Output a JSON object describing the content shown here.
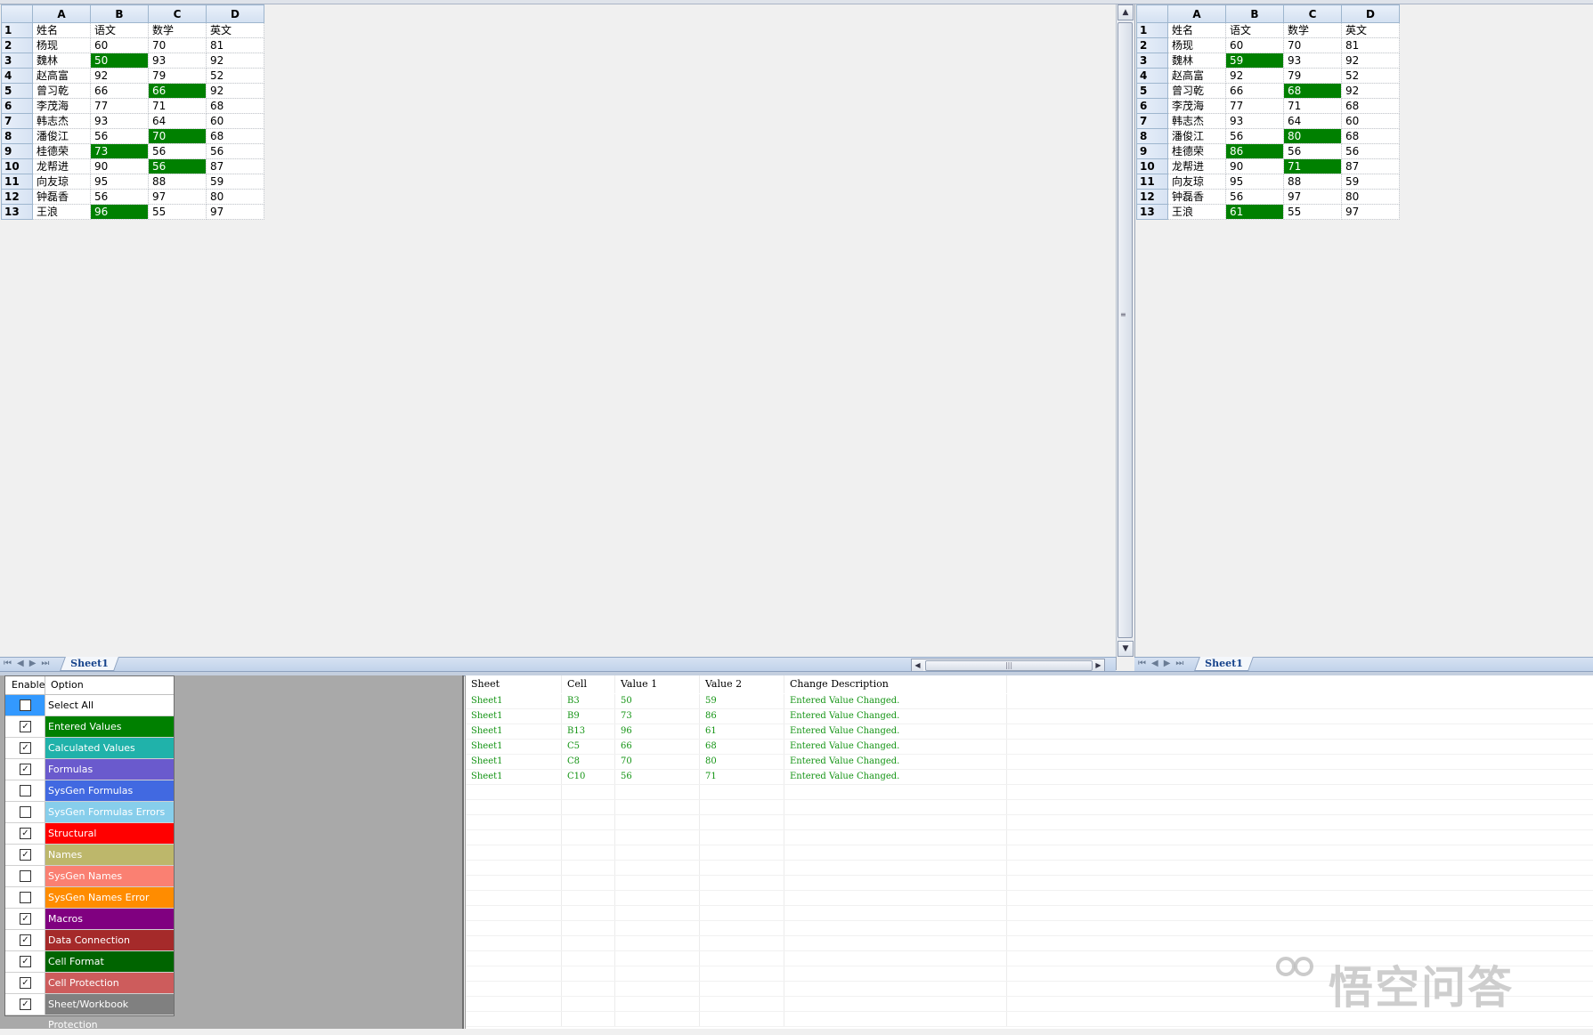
{
  "columns": [
    "A",
    "B",
    "C",
    "D"
  ],
  "left_sheet": {
    "rows": [
      {
        "n": "1",
        "cells": [
          "姓名",
          "语文",
          "数学",
          "英文"
        ],
        "hl": []
      },
      {
        "n": "2",
        "cells": [
          "杨现",
          "60",
          "70",
          "81"
        ],
        "hl": []
      },
      {
        "n": "3",
        "cells": [
          "魏林",
          "50",
          "93",
          "92"
        ],
        "hl": [
          1
        ]
      },
      {
        "n": "4",
        "cells": [
          "赵高富",
          "92",
          "79",
          "52"
        ],
        "hl": []
      },
      {
        "n": "5",
        "cells": [
          "曾习乾",
          "66",
          "66",
          "92"
        ],
        "hl": [
          2
        ]
      },
      {
        "n": "6",
        "cells": [
          "李茂海",
          "77",
          "71",
          "68"
        ],
        "hl": []
      },
      {
        "n": "7",
        "cells": [
          "韩志杰",
          "93",
          "64",
          "60"
        ],
        "hl": []
      },
      {
        "n": "8",
        "cells": [
          "潘俊江",
          "56",
          "70",
          "68"
        ],
        "hl": [
          2
        ]
      },
      {
        "n": "9",
        "cells": [
          "桂德荣",
          "73",
          "56",
          "56"
        ],
        "hl": [
          1
        ]
      },
      {
        "n": "10",
        "cells": [
          "龙帮进",
          "90",
          "56",
          "87"
        ],
        "hl": [
          2
        ]
      },
      {
        "n": "11",
        "cells": [
          "向友琼",
          "95",
          "88",
          "59"
        ],
        "hl": []
      },
      {
        "n": "12",
        "cells": [
          "钟磊香",
          "56",
          "97",
          "80"
        ],
        "hl": []
      },
      {
        "n": "13",
        "cells": [
          "王浪",
          "96",
          "55",
          "97"
        ],
        "hl": [
          1
        ]
      }
    ],
    "tab": "Sheet1"
  },
  "right_sheet": {
    "rows": [
      {
        "n": "1",
        "cells": [
          "姓名",
          "语文",
          "数学",
          "英文"
        ],
        "hl": []
      },
      {
        "n": "2",
        "cells": [
          "杨现",
          "60",
          "70",
          "81"
        ],
        "hl": []
      },
      {
        "n": "3",
        "cells": [
          "魏林",
          "59",
          "93",
          "92"
        ],
        "hl": [
          1
        ]
      },
      {
        "n": "4",
        "cells": [
          "赵高富",
          "92",
          "79",
          "52"
        ],
        "hl": []
      },
      {
        "n": "5",
        "cells": [
          "曾习乾",
          "66",
          "68",
          "92"
        ],
        "hl": [
          2
        ]
      },
      {
        "n": "6",
        "cells": [
          "李茂海",
          "77",
          "71",
          "68"
        ],
        "hl": []
      },
      {
        "n": "7",
        "cells": [
          "韩志杰",
          "93",
          "64",
          "60"
        ],
        "hl": []
      },
      {
        "n": "8",
        "cells": [
          "潘俊江",
          "56",
          "80",
          "68"
        ],
        "hl": [
          2
        ]
      },
      {
        "n": "9",
        "cells": [
          "桂德荣",
          "86",
          "56",
          "56"
        ],
        "hl": [
          1
        ]
      },
      {
        "n": "10",
        "cells": [
          "龙帮进",
          "90",
          "71",
          "87"
        ],
        "hl": [
          2
        ]
      },
      {
        "n": "11",
        "cells": [
          "向友琼",
          "95",
          "88",
          "59"
        ],
        "hl": []
      },
      {
        "n": "12",
        "cells": [
          "钟磊香",
          "56",
          "97",
          "80"
        ],
        "hl": []
      },
      {
        "n": "13",
        "cells": [
          "王浪",
          "61",
          "55",
          "97"
        ],
        "hl": [
          1
        ]
      }
    ],
    "tab": "Sheet1"
  },
  "highlight_color": "#008000",
  "options": {
    "header_enable": "Enable",
    "header_option": "Option",
    "items": [
      {
        "label": "Select All",
        "checked": false,
        "color": "#ffffff",
        "selected": true
      },
      {
        "label": "Entered Values",
        "checked": true,
        "color": "#008000"
      },
      {
        "label": "Calculated Values",
        "checked": true,
        "color": "#20b2aa"
      },
      {
        "label": "Formulas",
        "checked": true,
        "color": "#6a5acd"
      },
      {
        "label": "SysGen Formulas",
        "checked": false,
        "color": "#4169e1"
      },
      {
        "label": "SysGen Formulas Errors",
        "checked": false,
        "color": "#87ceeb"
      },
      {
        "label": "Structural",
        "checked": true,
        "color": "#ff0000"
      },
      {
        "label": "Names",
        "checked": true,
        "color": "#bdb76b"
      },
      {
        "label": "SysGen Names",
        "checked": false,
        "color": "#fa8072"
      },
      {
        "label": "SysGen Names Error",
        "checked": false,
        "color": "#ff8c00"
      },
      {
        "label": "Macros",
        "checked": true,
        "color": "#800080"
      },
      {
        "label": "Data Connection",
        "checked": true,
        "color": "#a52a2a"
      },
      {
        "label": "Cell Format",
        "checked": true,
        "color": "#006400"
      },
      {
        "label": "Cell Protection",
        "checked": true,
        "color": "#cd5c5c"
      },
      {
        "label": "Sheet/Workbook Protection",
        "checked": true,
        "color": "#808080"
      }
    ]
  },
  "changes": {
    "headers": [
      "Sheet",
      "Cell",
      "Value 1",
      "Value 2",
      "Change Description"
    ],
    "rows": [
      [
        "Sheet1",
        "B3",
        "50",
        "59",
        "Entered Value Changed."
      ],
      [
        "Sheet1",
        "B9",
        "73",
        "86",
        "Entered Value Changed."
      ],
      [
        "Sheet1",
        "B13",
        "96",
        "61",
        "Entered Value Changed."
      ],
      [
        "Sheet1",
        "C5",
        "66",
        "68",
        "Entered Value Changed."
      ],
      [
        "Sheet1",
        "C8",
        "70",
        "80",
        "Entered Value Changed."
      ],
      [
        "Sheet1",
        "C10",
        "56",
        "71",
        "Entered Value Changed."
      ]
    ],
    "text_color": "#149414"
  },
  "watermark": {
    "text": "悟空问答"
  }
}
